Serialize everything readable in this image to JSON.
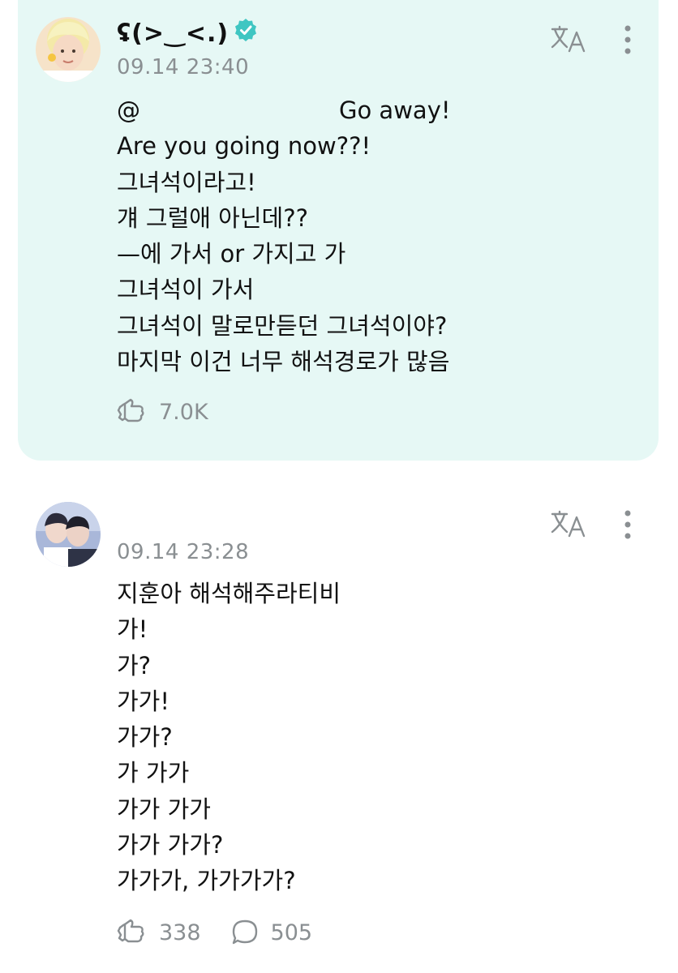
{
  "posts": [
    {
      "author": "ʢ(>‿<.)",
      "verified": true,
      "timestamp": "09.14 23:40",
      "mention": "@",
      "mention_message": "Go away!",
      "lines": [
        "Are you going now??!",
        "그녀석이라고!",
        "걔 그럴애 아닌데??",
        "—에 가서 or 가지고 가",
        "그녀석이 가서",
        "그녀석이 말로만듣던 그녀석이야?",
        "마지막 이건 너무 해석경로가 많음"
      ],
      "like_count": "7.0K",
      "highlighted": true
    },
    {
      "author": "",
      "timestamp": "09.14 23:28",
      "lines": [
        "지훈아 해석해주라티비",
        "가!",
        "가?",
        "가가!",
        "가가?",
        "가 가가",
        "가가 가가",
        "가가 가가?",
        "가가가, 가가가가?"
      ],
      "like_count": "338",
      "comment_count": "505"
    }
  ],
  "icons": {
    "translate": "translate-icon",
    "more": "more-vertical-icon",
    "like": "like-icon",
    "comment": "comment-icon",
    "verified": "verified-badge-icon"
  },
  "colors": {
    "highlight_bg": "#e6f8f5",
    "accent": "#3fc6c2",
    "muted": "#8a8f92"
  }
}
